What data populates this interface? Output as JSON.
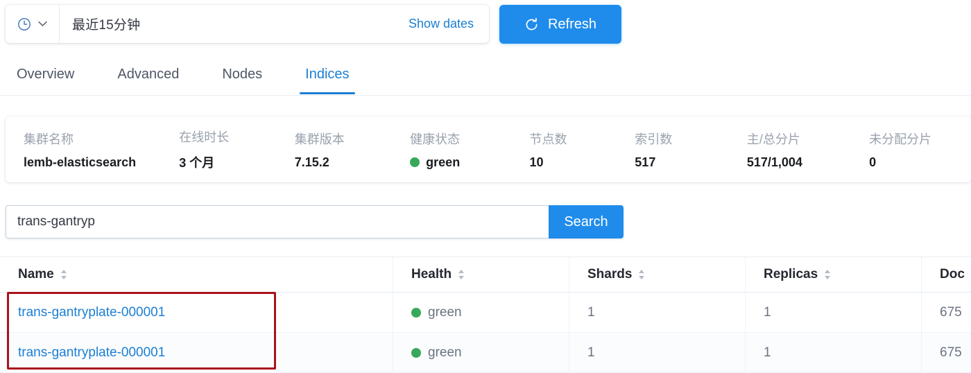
{
  "datepicker": {
    "clock_icon": "clock-icon",
    "chevron_icon": "chevron-down-icon",
    "range_label": "最近15分钟",
    "show_dates_label": "Show dates",
    "refresh_label": "Refresh",
    "refresh_icon": "refresh-icon"
  },
  "tabs": [
    {
      "label": "Overview",
      "active": false
    },
    {
      "label": "Advanced",
      "active": false
    },
    {
      "label": "Nodes",
      "active": false
    },
    {
      "label": "Indices",
      "active": true
    }
  ],
  "cluster": {
    "stats": [
      {
        "label": "集群名称",
        "value": "lemb-elasticsearch",
        "dot": false
      },
      {
        "label": "在线时长",
        "value": "3 个月",
        "dot": false
      },
      {
        "label": "集群版本",
        "value": "7.15.2",
        "dot": false
      },
      {
        "label": "健康状态",
        "value": "green",
        "dot": true
      },
      {
        "label": "节点数",
        "value": "10",
        "dot": false
      },
      {
        "label": "索引数",
        "value": "517",
        "dot": false
      },
      {
        "label": "主/总分片",
        "value": "517/1,004",
        "dot": false
      },
      {
        "label": "未分配分片",
        "value": "0",
        "dot": false
      }
    ]
  },
  "search": {
    "value": "trans-gantryp",
    "placeholder": "",
    "button_label": "Search"
  },
  "table": {
    "columns": [
      {
        "label": "Name",
        "sortable": true
      },
      {
        "label": "Health",
        "sortable": true
      },
      {
        "label": "Shards",
        "sortable": true
      },
      {
        "label": "Replicas",
        "sortable": true
      },
      {
        "label": "Doc",
        "sortable": false
      }
    ],
    "rows": [
      {
        "name": "trans-gantryplate-000001",
        "health": "green",
        "shards": "1",
        "replicas": "1",
        "docs": "675"
      },
      {
        "name": "trans-gantryplate-000001",
        "health": "green",
        "shards": "1",
        "replicas": "1",
        "docs": "675"
      }
    ]
  },
  "annotation": {
    "color": "#a9121b",
    "target": "name-column-results"
  },
  "colors": {
    "accent_blue": "#1f8ceb",
    "link_blue": "#1b7fd4",
    "health_green": "#37a85a",
    "annotation_red": "#a9121b"
  }
}
